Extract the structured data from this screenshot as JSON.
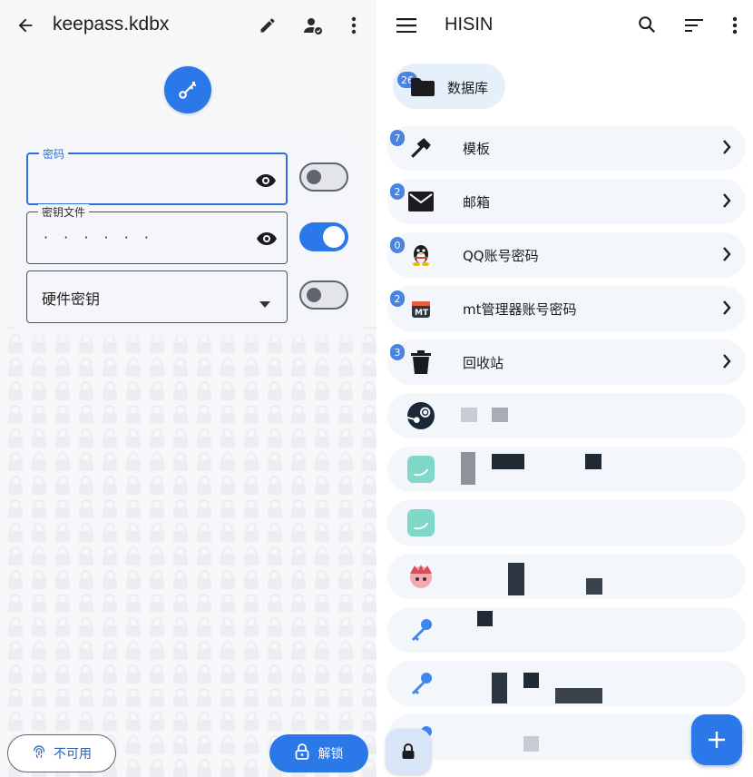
{
  "left": {
    "title": "keepass.kdbx",
    "fields": {
      "password": {
        "label": "密码",
        "value": ""
      },
      "keyfile": {
        "label": "密钥文件",
        "value": "· · · · · ·"
      },
      "hardware_key": {
        "label": "硬件密钥"
      }
    },
    "switches": {
      "password": false,
      "keyfile": true,
      "hardware_key": false
    },
    "buttons": {
      "biometric": "不可用",
      "unlock": "解锁"
    }
  },
  "right": {
    "title": "HISIN",
    "root_group": {
      "count": "26",
      "label": "数据库"
    },
    "groups": [
      {
        "count": "7",
        "label": "模板",
        "icon": "hammer-icon"
      },
      {
        "count": "2",
        "label": "邮箱",
        "icon": "mail-icon"
      },
      {
        "count": "0",
        "label": "QQ账号密码",
        "icon": "qq-penguin-icon"
      },
      {
        "count": "2",
        "label": "mt管理器账号密码",
        "icon": "mt-manager-icon"
      },
      {
        "count": "3",
        "label": "回收站",
        "icon": "trash-icon"
      }
    ],
    "entries": [
      {
        "icon": "steam-icon"
      },
      {
        "icon": "app-icon"
      },
      {
        "icon": "app-icon"
      },
      {
        "icon": "avatar-icon"
      },
      {
        "icon": "key-icon"
      },
      {
        "icon": "key-icon"
      },
      {
        "icon": "key-icon"
      }
    ]
  },
  "colors": {
    "accent": "#2b78e8",
    "row_bg": "#f3f6fa",
    "chip_bg": "#e6f0fb"
  }
}
